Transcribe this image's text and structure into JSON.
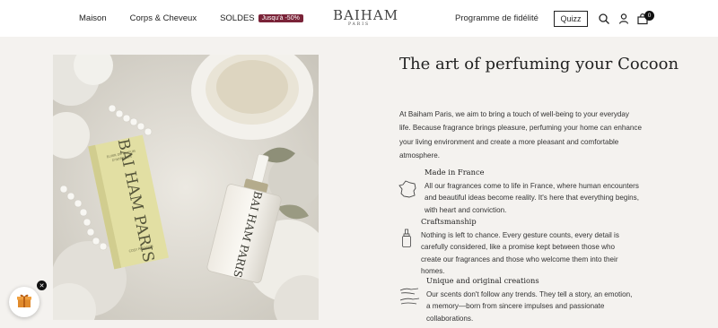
{
  "header": {
    "nav": [
      {
        "label": "Maison"
      },
      {
        "label": "Corps & Cheveux"
      },
      {
        "label": "SOLDES",
        "badge": "Jusqu'à -50%"
      }
    ],
    "logo": {
      "main": "BAIHAM",
      "sub": "PARIS"
    },
    "fidelity_label": "Programme de fidélité",
    "quiz_label": "Quizz",
    "cart_count": "0",
    "icons": [
      "search-icon",
      "account-icon",
      "cart-icon"
    ]
  },
  "product_photo": {
    "box_text": "BAI HAM PARIS",
    "box_small_lines": [
      "ELIXIR DE PARFUM",
      "D'INTÉRIEUR",
      "COSY PARADISE"
    ],
    "bottle_text": "BAI HAM PARIS"
  },
  "content": {
    "title": "The art of perfuming your Cocoon",
    "intro": "At Baiham Paris, we aim to bring a touch of well-being to your everyday life. Because fragrance brings pleasure, perfuming your home can enhance your living environment and create a more pleasant and comfortable atmosphere.",
    "features": [
      {
        "title": "Made in France",
        "icon": "france-map-icon",
        "text": "All our fragrances come to life in France, where human encounters and beautiful ideas become reality. It's here that everything begins, with heart and conviction."
      },
      {
        "title": "Craftsmanship",
        "icon": "perfume-bottle-icon",
        "text": "Nothing is left to chance. Every gesture counts, every detail is carefully considered, like a promise kept between those who create our fragrances and those who welcome them into their homes."
      },
      {
        "title": "Unique and original creations",
        "icon": "creation-hand-icon",
        "text": "Our scents don't follow any trends. They tell a story, an emotion, a memory—born from sincere impulses and passionate collaborations."
      }
    ]
  },
  "widget": {
    "close_glyph": "✕",
    "icon": "gift-icon"
  },
  "colors": {
    "badge": "#7a2338",
    "background": "#f4f2ef",
    "box": "#e2dfa3"
  }
}
